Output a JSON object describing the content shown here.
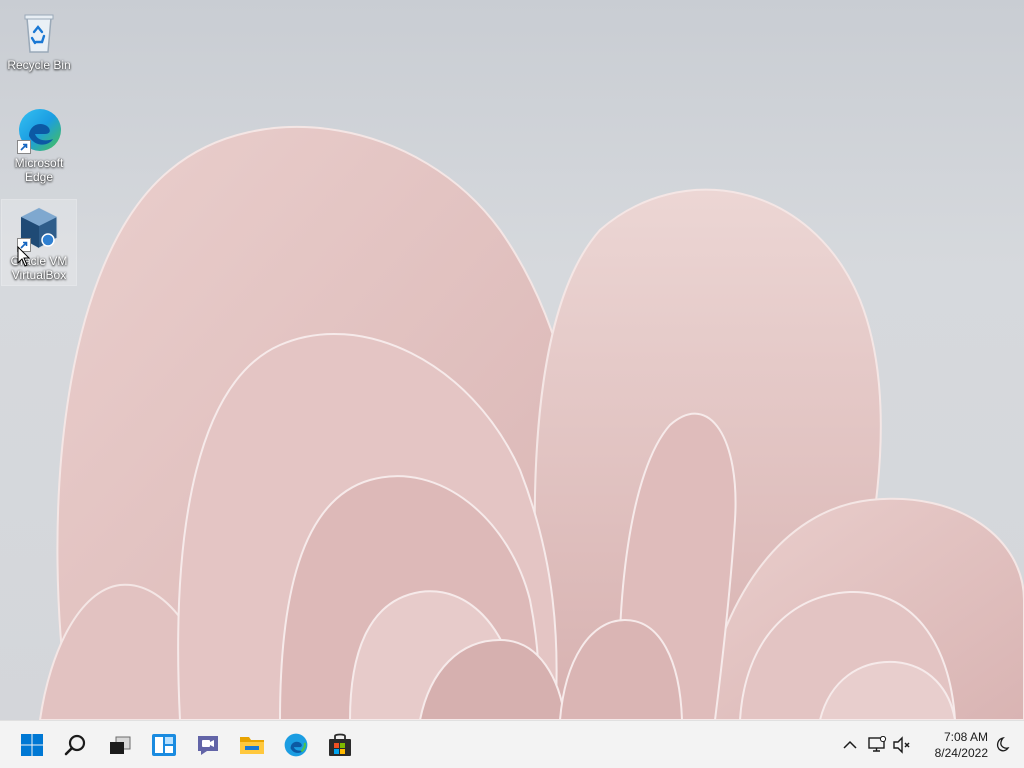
{
  "desktop": {
    "icons": [
      {
        "label": "Recycle Bin"
      },
      {
        "label": "Microsoft Edge"
      },
      {
        "label": "Oracle VM VirtualBox"
      }
    ]
  },
  "taskbar": {
    "items": [
      {
        "icon": "windows-start-icon"
      },
      {
        "icon": "search-icon"
      },
      {
        "icon": "task-view-icon"
      },
      {
        "icon": "widgets-icon"
      },
      {
        "icon": "chat-icon"
      },
      {
        "icon": "file-explorer-icon"
      },
      {
        "icon": "edge-icon"
      },
      {
        "icon": "microsoft-store-icon"
      }
    ],
    "tray": {
      "icons": [
        "chevron-up-icon",
        "network-icon",
        "volume-muted-icon",
        "notification-moon-icon"
      ],
      "time": "7:08 AM",
      "date": "8/24/2022"
    }
  },
  "colors": {
    "taskbar_bg": "#f3f3f3",
    "accent": "#0067c0",
    "wallpaper_petal": "#e6c9c8"
  }
}
